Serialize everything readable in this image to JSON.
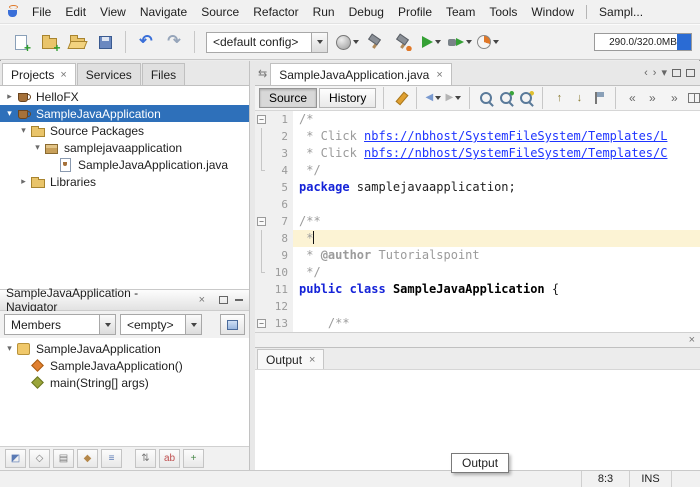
{
  "menubar": {
    "items": [
      "File",
      "Edit",
      "View",
      "Navigate",
      "Source",
      "Refactor",
      "Run",
      "Debug",
      "Profile",
      "Team",
      "Tools",
      "Window"
    ],
    "extra": "Sampl..."
  },
  "toolbar": {
    "file_icons": [
      {
        "name": "new-file"
      },
      {
        "name": "new-project"
      },
      {
        "name": "open-project"
      },
      {
        "name": "save-all"
      }
    ],
    "edit_icons": [
      {
        "name": "undo"
      },
      {
        "name": "redo"
      }
    ],
    "config_value": "<default config>",
    "run_icons": [
      {
        "name": "browser",
        "dd": true
      },
      {
        "name": "build-project"
      },
      {
        "name": "clean-build-project"
      },
      {
        "name": "run-project",
        "dd": true
      },
      {
        "name": "debug-project",
        "dd": true
      },
      {
        "name": "profile-project",
        "dd": true
      }
    ],
    "memory_label": "290.0/320.0MB"
  },
  "projects_panel": {
    "tabs": [
      {
        "label": "Projects",
        "active": true,
        "closable": true
      },
      {
        "label": "Services"
      },
      {
        "label": "Files"
      }
    ],
    "tree": [
      {
        "label": "HelloFX",
        "icon": "java-project",
        "indent": 0,
        "arrow": "collapsed"
      },
      {
        "label": "SampleJavaApplication",
        "icon": "java-project",
        "indent": 0,
        "arrow": "expanded",
        "selected": true
      },
      {
        "label": "Source Packages",
        "icon": "source-folder",
        "indent": 1,
        "arrow": "expanded"
      },
      {
        "label": "samplejavaapplication",
        "icon": "package",
        "indent": 2,
        "arrow": "expanded"
      },
      {
        "label": "SampleJavaApplication.java",
        "icon": "java-file",
        "indent": 3
      },
      {
        "label": "Libraries",
        "icon": "libraries-folder",
        "indent": 1,
        "arrow": "collapsed"
      }
    ]
  },
  "navigator_panel": {
    "title": "SampleJavaApplication - Navigator",
    "closable": true,
    "members_filter": "Members",
    "secondary_filter": "<empty>",
    "tree": [
      {
        "label": "SampleJavaApplication",
        "icon": "class",
        "indent": 0,
        "arrow": "expanded"
      },
      {
        "label": "SampleJavaApplication()",
        "icon": "constructor",
        "indent": 1
      },
      {
        "label": "main(String[] args)",
        "icon": "method",
        "indent": 1
      }
    ],
    "filter_icons": [
      "show-inherited",
      "show-fields",
      "show-static",
      "show-non-public",
      "sort-by-name",
      "sort-by-source",
      "fully-qualified-names",
      "expand-all"
    ]
  },
  "editor": {
    "tab": {
      "label": "SampleJavaApplication.java",
      "closable": true
    },
    "view_buttons": [
      {
        "label": "Source",
        "active": true
      },
      {
        "label": "History"
      }
    ],
    "toolbar_groups": [
      [
        "last-edit"
      ],
      [
        "back",
        "forward"
      ],
      [
        "find-selection",
        "find-occurrences",
        "toggle-highlight"
      ],
      [
        "previous-bookmark",
        "next-bookmark",
        "toggle-bookmark"
      ],
      [
        "shift-left",
        "shift-right"
      ]
    ],
    "toolbar_right": [
      "overflow",
      "split"
    ],
    "lines": [
      {
        "n": 1,
        "fold": true,
        "segs": [
          {
            "t": "/*",
            "c": "comment"
          }
        ]
      },
      {
        "n": 2,
        "guide": "mid",
        "segs": [
          {
            "t": " * Click ",
            "c": "comment"
          },
          {
            "t": "nbfs://nbhost/SystemFileSystem/Templates/L",
            "c": "link"
          }
        ]
      },
      {
        "n": 3,
        "guide": "mid",
        "segs": [
          {
            "t": " * Click ",
            "c": "comment"
          },
          {
            "t": "nbfs://nbhost/SystemFileSystem/Templates/C",
            "c": "link"
          }
        ]
      },
      {
        "n": 4,
        "guide": "end",
        "segs": [
          {
            "t": " */",
            "c": "comment"
          }
        ]
      },
      {
        "n": 5,
        "segs": [
          {
            "t": "package",
            "c": "keyword"
          },
          {
            "t": " samplejavaapplication;",
            "c": "plain"
          }
        ]
      },
      {
        "n": 6,
        "segs": []
      },
      {
        "n": 7,
        "fold": true,
        "segs": [
          {
            "t": "/**",
            "c": "comment"
          }
        ]
      },
      {
        "n": 8,
        "current": true,
        "caret": true,
        "guide": "mid",
        "segs": [
          {
            "t": " *",
            "c": "comment"
          }
        ]
      },
      {
        "n": 9,
        "guide": "mid",
        "segs": [
          {
            "t": " * ",
            "c": "comment"
          },
          {
            "t": "@author",
            "c": "javadoc"
          },
          {
            "t": " Tutorialspoint",
            "c": "comment"
          }
        ]
      },
      {
        "n": 10,
        "guide": "end",
        "segs": [
          {
            "t": " */",
            "c": "comment"
          }
        ]
      },
      {
        "n": 11,
        "segs": [
          {
            "t": "public class",
            "c": "keyword"
          },
          {
            "t": " ",
            "c": "plain"
          },
          {
            "t": "SampleJavaApplication",
            "c": "type"
          },
          {
            "t": " {",
            "c": "plain"
          }
        ]
      },
      {
        "n": 12,
        "segs": []
      },
      {
        "n": 13,
        "fold": true,
        "segs": [
          {
            "t": "    /**",
            "c": "comment"
          }
        ]
      }
    ]
  },
  "output_panel": {
    "tab": {
      "label": "Output",
      "closable": true
    }
  },
  "statusbar": {
    "caret_position": "8:3",
    "typing_mode": "INS"
  },
  "tooltip": {
    "text": "Output"
  },
  "colors": {
    "selection": "#2e70ba",
    "current_line": "#fcf3d4",
    "keyword": "#1523d8",
    "comment": "#9b9b9b",
    "link": "#1f35ff",
    "memory_used": "#2a6bd4"
  }
}
